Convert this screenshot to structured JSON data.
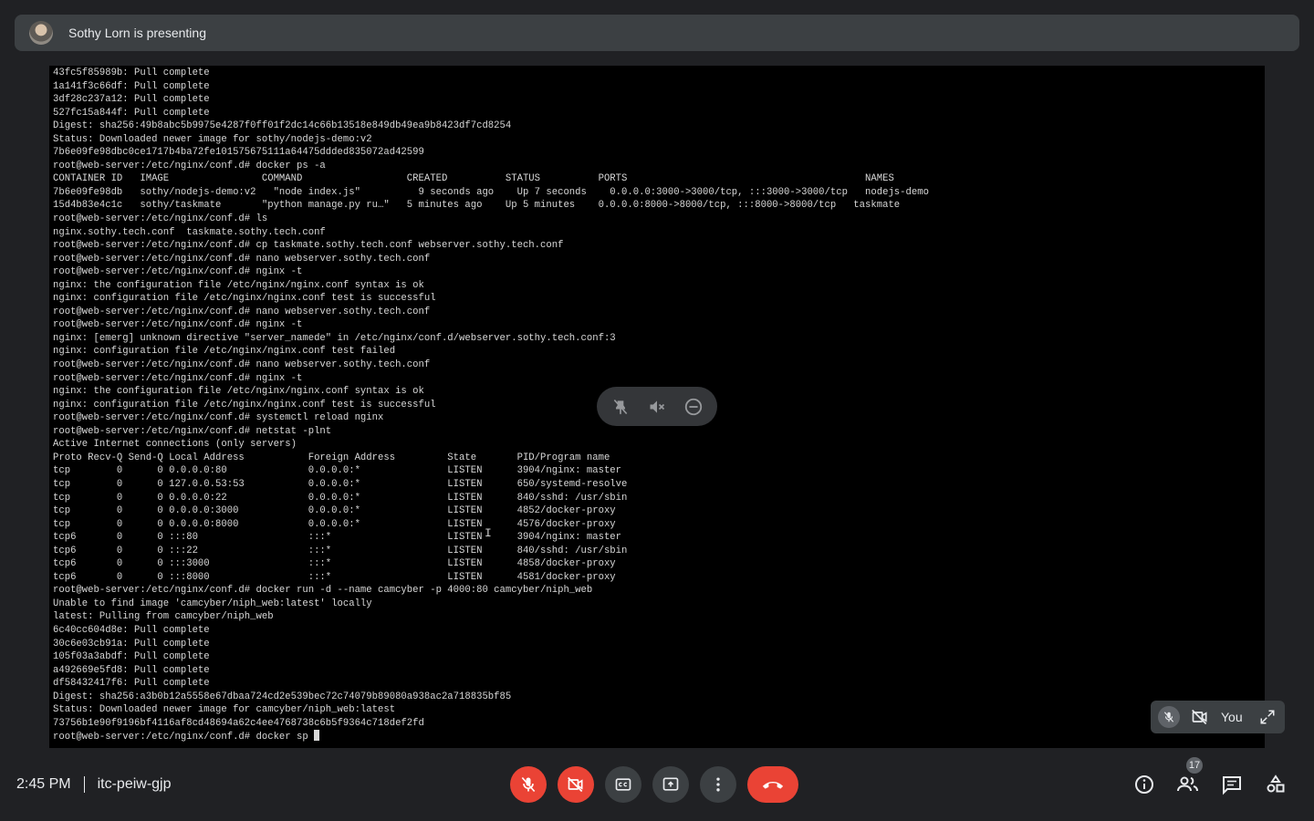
{
  "presenter": {
    "name_text": "Sothy Lorn is presenting"
  },
  "terminal": {
    "lines": [
      "43fc5f85989b: Pull complete",
      "1a141f3c66df: Pull complete",
      "3df28c237a12: Pull complete",
      "527fc15a844f: Pull complete",
      "Digest: sha256:49b8abc5b9975e4287f0ff01f2dc14c66b13518e849db49ea9b8423df7cd8254",
      "Status: Downloaded newer image for sothy/nodejs-demo:v2",
      "7b6e09fe98dbc0ce1717b4ba72fe101575675111a64475ddded835072ad42599",
      "root@web-server:/etc/nginx/conf.d# docker ps -a",
      "CONTAINER ID   IMAGE                COMMAND                  CREATED          STATUS          PORTS                                         NAMES",
      "7b6e09fe98db   sothy/nodejs-demo:v2   \"node index.js\"          9 seconds ago    Up 7 seconds    0.0.0.0:3000->3000/tcp, :::3000->3000/tcp   nodejs-demo",
      "15d4b83e4c1c   sothy/taskmate       \"python manage.py ru…\"   5 minutes ago    Up 5 minutes    0.0.0.0:8000->8000/tcp, :::8000->8000/tcp   taskmate",
      "root@web-server:/etc/nginx/conf.d# ls",
      "nginx.sothy.tech.conf  taskmate.sothy.tech.conf",
      "root@web-server:/etc/nginx/conf.d# cp taskmate.sothy.tech.conf webserver.sothy.tech.conf",
      "root@web-server:/etc/nginx/conf.d# nano webserver.sothy.tech.conf",
      "root@web-server:/etc/nginx/conf.d# nginx -t",
      "nginx: the configuration file /etc/nginx/nginx.conf syntax is ok",
      "nginx: configuration file /etc/nginx/nginx.conf test is successful",
      "root@web-server:/etc/nginx/conf.d# nano webserver.sothy.tech.conf",
      "root@web-server:/etc/nginx/conf.d# nginx -t",
      "nginx: [emerg] unknown directive \"server_namede\" in /etc/nginx/conf.d/webserver.sothy.tech.conf:3",
      "nginx: configuration file /etc/nginx/nginx.conf test failed",
      "root@web-server:/etc/nginx/conf.d# nano webserver.sothy.tech.conf",
      "root@web-server:/etc/nginx/conf.d# nginx -t",
      "nginx: the configuration file /etc/nginx/nginx.conf syntax is ok",
      "nginx: configuration file /etc/nginx/nginx.conf test is successful",
      "root@web-server:/etc/nginx/conf.d# systemctl reload nginx",
      "root@web-server:/etc/nginx/conf.d# netstat -plnt",
      "Active Internet connections (only servers)",
      "Proto Recv-Q Send-Q Local Address           Foreign Address         State       PID/Program name",
      "tcp        0      0 0.0.0.0:80              0.0.0.0:*               LISTEN      3904/nginx: master",
      "tcp        0      0 127.0.0.53:53           0.0.0.0:*               LISTEN      650/systemd-resolve",
      "tcp        0      0 0.0.0.0:22              0.0.0.0:*               LISTEN      840/sshd: /usr/sbin",
      "tcp        0      0 0.0.0.0:3000            0.0.0.0:*               LISTEN      4852/docker-proxy",
      "tcp        0      0 0.0.0.0:8000            0.0.0.0:*               LISTEN      4576/docker-proxy",
      "tcp6       0      0 :::80                   :::*                    LISTEN      3904/nginx: master",
      "tcp6       0      0 :::22                   :::*                    LISTEN      840/sshd: /usr/sbin",
      "tcp6       0      0 :::3000                 :::*                    LISTEN      4858/docker-proxy",
      "tcp6       0      0 :::8000                 :::*                    LISTEN      4581/docker-proxy",
      "root@web-server:/etc/nginx/conf.d# docker run -d --name camcyber -p 4000:80 camcyber/niph_web",
      "Unable to find image 'camcyber/niph_web:latest' locally",
      "latest: Pulling from camcyber/niph_web",
      "6c40cc604d8e: Pull complete",
      "30c6e03cb91a: Pull complete",
      "105f03a3abdf: Pull complete",
      "a492669e5fd8: Pull complete",
      "df58432417f6: Pull complete",
      "Digest: sha256:a3b0b12a5558e67dbaa724cd2e539bec72c74079b89080a938ac2a718835bf85",
      "Status: Downloaded newer image for camcyber/niph_web:latest",
      "73756b1e90f9196bf4116af8cd48694a62c4ee4768738c6b5f9364c718def2fd"
    ],
    "prompt_line": "root@web-server:/etc/nginx/conf.d# docker sp "
  },
  "self_view": {
    "label": "You"
  },
  "meeting": {
    "time": "2:45 PM",
    "code": "itc-peiw-gjp"
  },
  "participants": {
    "count": "17"
  },
  "icons": {
    "mic_off": "mic-off-icon",
    "camera_off": "videocam-off-icon",
    "captions": "closed-caption-icon",
    "present": "present-screen-icon",
    "more": "more-vert-icon",
    "end_call": "call-end-icon",
    "info": "info-icon",
    "people": "people-icon",
    "chat": "chat-icon",
    "activities": "activities-icon"
  },
  "colors": {
    "bg": "#202124",
    "surface": "#3c4043",
    "danger": "#ea4335",
    "text": "#e8eaed"
  }
}
